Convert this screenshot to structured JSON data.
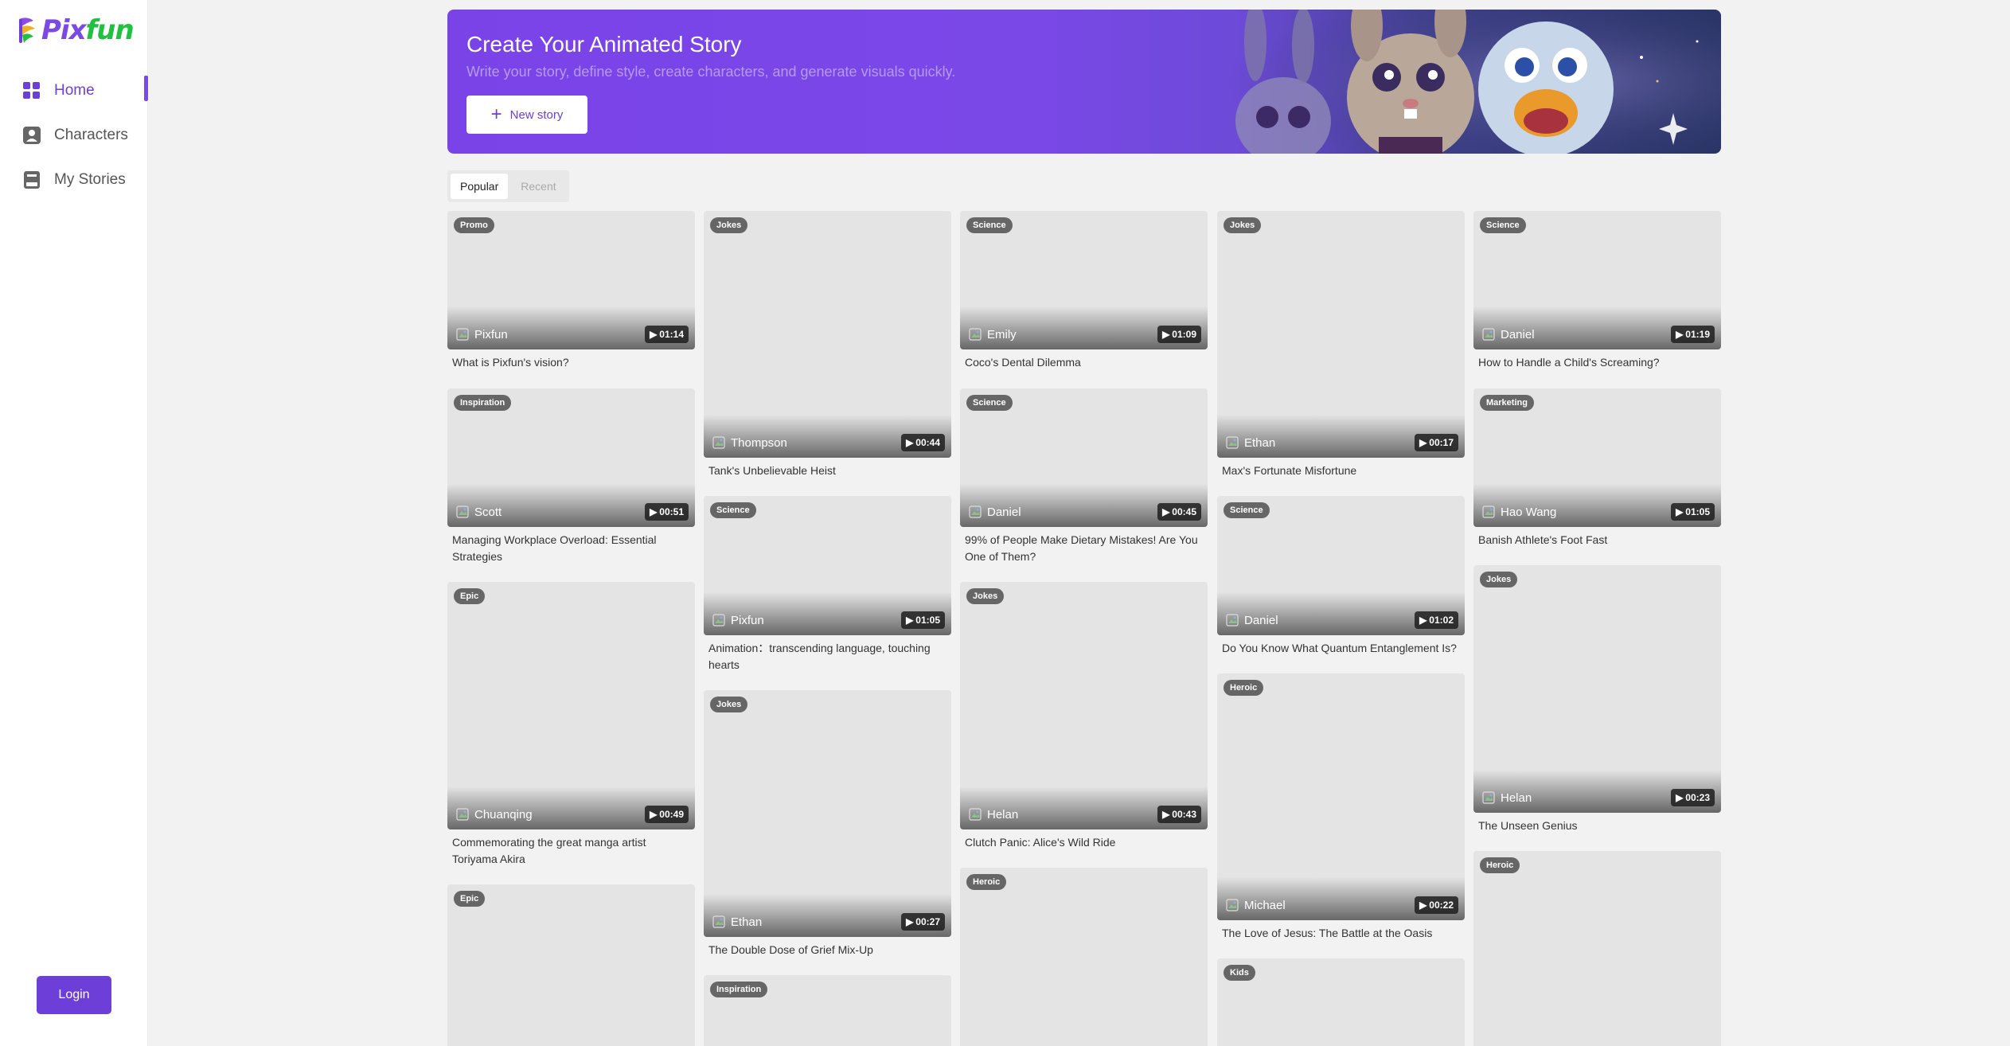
{
  "brand": {
    "name_part1": "Pix",
    "name_part2": "fun"
  },
  "sidebar": {
    "items": [
      {
        "label": "Home",
        "icon": "grid-icon",
        "active": true
      },
      {
        "label": "Characters",
        "icon": "person-icon",
        "active": false
      },
      {
        "label": "My Stories",
        "icon": "book-icon",
        "active": false
      }
    ],
    "login_label": "Login"
  },
  "banner": {
    "title": "Create Your Animated Story",
    "subtitle": "Write your story, define style, create characters, and generate visuals quickly.",
    "button_label": "New story"
  },
  "tabs": [
    {
      "label": "Popular",
      "active": true
    },
    {
      "label": "Recent",
      "active": false
    }
  ],
  "cards": [
    {
      "tag": "Promo",
      "author": "Pixfun",
      "duration": "01:14",
      "title": "What is Pixfun's vision?"
    },
    {
      "tag": "Jokes",
      "author": "Thompson",
      "duration": "00:44",
      "title": "Tank's Unbelievable Heist"
    },
    {
      "tag": "Science",
      "author": "Emily",
      "duration": "01:09",
      "title": "Coco's Dental Dilemma"
    },
    {
      "tag": "Jokes",
      "author": "Ethan",
      "duration": "00:17",
      "title": "Max's Fortunate Misfortune"
    },
    {
      "tag": "Science",
      "author": "Daniel",
      "duration": "01:19",
      "title": "How to Handle a Child's Screaming?"
    },
    {
      "tag": "Inspiration",
      "author": "Scott",
      "duration": "00:51",
      "title": "Managing Workplace Overload: Essential Strategies"
    },
    {
      "tag": "Science",
      "author": "Pixfun",
      "duration": "01:05",
      "title": "Animation：transcending language, touching hearts"
    },
    {
      "tag": "Science",
      "author": "Daniel",
      "duration": "00:45",
      "title": "99% of People Make Dietary Mistakes! Are You One of Them?"
    },
    {
      "tag": "Science",
      "author": "Daniel",
      "duration": "01:02",
      "title": "Do You Know What Quantum Entanglement Is?"
    },
    {
      "tag": "Marketing",
      "author": "Hao Wang",
      "duration": "01:05",
      "title": "Banish Athlete's Foot Fast"
    },
    {
      "tag": "Epic",
      "author": "Chuanqing",
      "duration": "00:49",
      "title": "Commemorating the great manga artist Toriyama Akira"
    },
    {
      "tag": "Jokes",
      "author": "Ethan",
      "duration": "00:27",
      "title": "The Double Dose of Grief Mix-Up"
    },
    {
      "tag": "Jokes",
      "author": "Helan",
      "duration": "00:43",
      "title": "Clutch Panic: Alice's Wild Ride"
    },
    {
      "tag": "Heroic",
      "author": "Michael",
      "duration": "00:22",
      "title": "The Love of Jesus: The Battle at the Oasis"
    },
    {
      "tag": "Jokes",
      "author": "Helan",
      "duration": "00:23",
      "title": "The Unseen Genius"
    },
    {
      "tag": "Epic"
    },
    {
      "tag": "Inspiration"
    },
    {
      "tag": "Heroic"
    },
    {
      "tag": "Kids"
    },
    {
      "tag": "Heroic"
    }
  ],
  "colors": {
    "accent": "#7a4ae6",
    "banner_start": "#7a43e8",
    "banner_end": "#2a3566",
    "card_bg": "#e4e4e4"
  }
}
